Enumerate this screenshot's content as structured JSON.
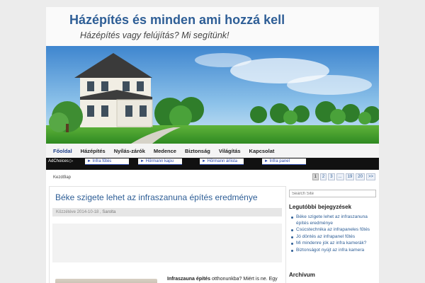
{
  "site": {
    "title": "Házépítés és minden ami hozzá kell",
    "tagline": "Házépítés vagy felújítás? Mi segítünk!"
  },
  "menu": {
    "items": [
      {
        "label": "Főoldal",
        "active": true
      },
      {
        "label": "Házépítés"
      },
      {
        "label": "Nyílás-zárók"
      },
      {
        "label": "Medence"
      },
      {
        "label": "Biztonság"
      },
      {
        "label": "Világítás"
      },
      {
        "label": "Kapcsolat"
      }
    ]
  },
  "adbar": {
    "choices": "AdChoices ▷",
    "links": [
      "► Infra fűtés",
      "► Hörmann kapu",
      "► Hörmann árlista",
      "► Infra panel"
    ]
  },
  "breadcrumb": "Kezdőlap",
  "pagination": [
    "1",
    "2",
    "3",
    "...",
    "19",
    "20",
    ">>"
  ],
  "post": {
    "title": "Béke szigete lehet az infraszanuna építés eredménye",
    "meta_prefix": "Közzétéve 2014-10-18 ,",
    "author": "Sarolta",
    "text_bold": "Infraszauna építés",
    "text_rest": " otthonunkba? Miért is ne. Egy ház felépítésének költségei mellett"
  },
  "sidebar": {
    "search_placeholder": "Search Site",
    "recent_title": "Legutóbbi bejegyzések",
    "recent_posts": [
      "Béke szigete lehet az infraszanuna építés eredménye",
      "Csúcstechnika az infrapaneles fűtés",
      "Jó döntés az infrapanel fűtés",
      "Mi mindenre jók az infra kamerák?",
      "Biztonságot nyújt az infra kamera"
    ],
    "archive_title": "Archívum"
  },
  "colors": {
    "title_blue": "#2e5e96",
    "menu_active": "#1e3f8a",
    "ad_bar": "#111111"
  }
}
